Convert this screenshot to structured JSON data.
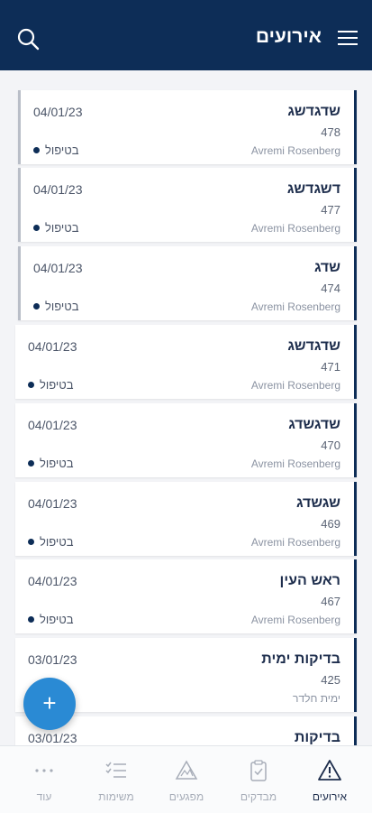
{
  "header": {
    "title": "אירועים",
    "menu_icon": "hamburger-menu-icon",
    "search_icon": "search-icon"
  },
  "events": [
    {
      "name": "שדגדשג",
      "number": "478",
      "owner": "Avremi Rosenberg",
      "date": "04/01/23",
      "status": "בטיפול"
    },
    {
      "name": "דשגדשג",
      "number": "477",
      "owner": "Avremi Rosenberg",
      "date": "04/01/23",
      "status": "בטיפול"
    },
    {
      "name": "שדג",
      "number": "474",
      "owner": "Avremi Rosenberg",
      "date": "04/01/23",
      "status": "בטיפול"
    },
    {
      "name": "שדגדשג",
      "number": "471",
      "owner": "Avremi Rosenberg",
      "date": "04/01/23",
      "status": "בטיפול"
    },
    {
      "name": "שדגשדג",
      "number": "470",
      "owner": "Avremi Rosenberg",
      "date": "04/01/23",
      "status": "בטיפול"
    },
    {
      "name": "שגשדג",
      "number": "469",
      "owner": "Avremi Rosenberg",
      "date": "04/01/23",
      "status": "בטיפול"
    },
    {
      "name": "ראש העין",
      "number": "467",
      "owner": "Avremi Rosenberg",
      "date": "04/01/23",
      "status": "בטיפול"
    },
    {
      "name": "בדיקות ימית",
      "number": "425",
      "owner": "ימית חלדר",
      "date": "03/01/23",
      "status": ""
    },
    {
      "name": "בדיקות",
      "number": "",
      "owner": "",
      "date": "03/01/23",
      "status": ""
    }
  ],
  "fab": {
    "label": "+"
  },
  "bottom_nav": [
    {
      "label": "עוד",
      "icon": "more-dots-icon"
    },
    {
      "label": "משימות",
      "icon": "checklist-icon"
    },
    {
      "label": "מפגעים",
      "icon": "hazard-icon"
    },
    {
      "label": "מבדקים",
      "icon": "clipboard-check-icon"
    },
    {
      "label": "אירועים",
      "icon": "warning-triangle-icon",
      "active": true
    }
  ],
  "colors": {
    "primary": "#0d2d57",
    "fab": "#2a8ad4",
    "background": "#f3f4f7"
  }
}
